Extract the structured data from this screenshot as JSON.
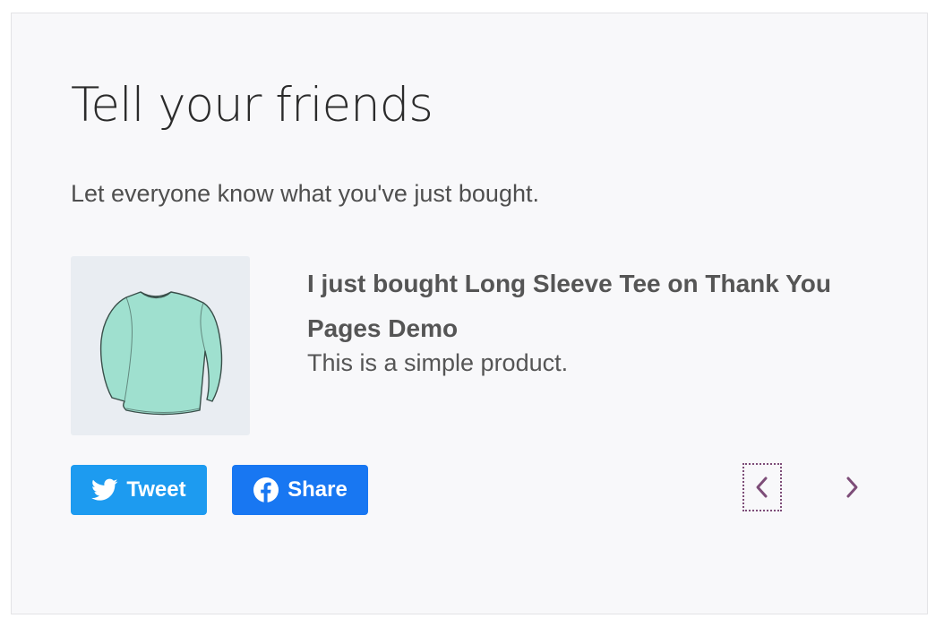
{
  "section": {
    "heading": "Tell your friends",
    "intro": "Let everyone know what you've just bought."
  },
  "product": {
    "title": "I just bought Long Sleeve Tee on Thank You Pages Demo",
    "description": "This is a simple product.",
    "image_icon": "long-sleeve-tee-illustration"
  },
  "share": {
    "tweet_label": "Tweet",
    "tweet_icon": "twitter-bird-icon",
    "tweet_color": "#1d9bf0",
    "share_label": "Share",
    "share_icon": "facebook-icon",
    "share_color": "#1877f2"
  },
  "carousel": {
    "prev_icon": "chevron-left-icon",
    "next_icon": "chevron-right-icon",
    "arrow_color": "#7d4d78"
  }
}
